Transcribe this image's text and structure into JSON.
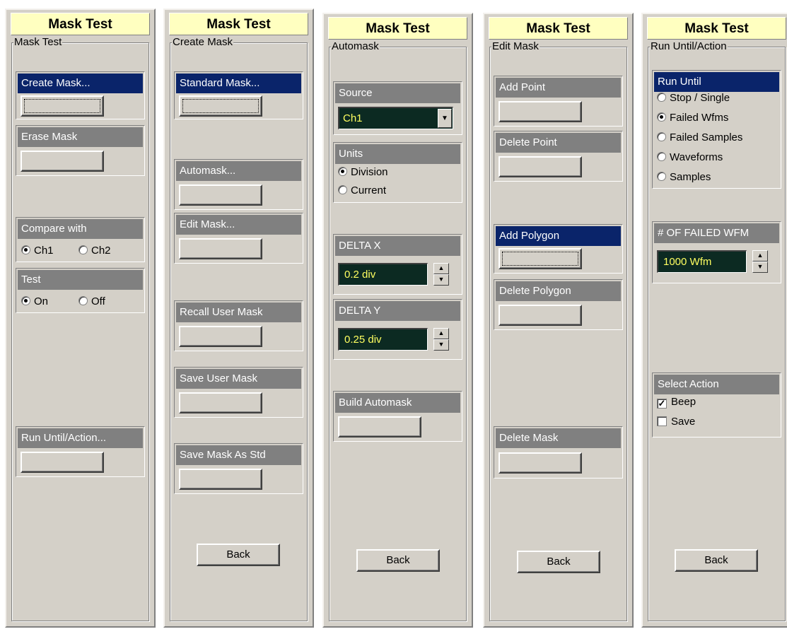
{
  "panels": [
    {
      "title": "Mask Test",
      "group_label": "Mask Test",
      "create_mask": "Create Mask...",
      "erase_mask": "Erase Mask",
      "compare_with": {
        "label": "Compare with",
        "options": [
          "Ch1",
          "Ch2"
        ],
        "selected": "Ch1"
      },
      "test": {
        "label": "Test",
        "options": [
          "On",
          "Off"
        ],
        "selected": "On"
      },
      "run_until_action": "Run Until/Action..."
    },
    {
      "title": "Mask Test",
      "group_label": "Create Mask",
      "standard_mask": "Standard Mask...",
      "automask": "Automask...",
      "edit_mask": "Edit Mask...",
      "recall_user_mask": "Recall User Mask",
      "save_user_mask": "Save User Mask",
      "save_mask_as_std": "Save Mask As Std",
      "back": "Back"
    },
    {
      "title": "Mask Test",
      "group_label": "Automask",
      "source": {
        "label": "Source",
        "value": "Ch1"
      },
      "units": {
        "label": "Units",
        "options": [
          "Division",
          "Current"
        ],
        "selected": "Division"
      },
      "delta_x": {
        "label": "DELTA X",
        "value": "0.2 div"
      },
      "delta_y": {
        "label": "DELTA Y",
        "value": "0.25 div"
      },
      "build_automask": "Build Automask",
      "back": "Back"
    },
    {
      "title": "Mask Test",
      "group_label": "Edit Mask",
      "add_point": "Add Point",
      "delete_point": "Delete Point",
      "add_polygon": "Add Polygon",
      "delete_polygon": "Delete Polygon",
      "delete_mask": "Delete Mask",
      "back": "Back"
    },
    {
      "title": "Mask Test",
      "group_label": "Run Until/Action",
      "run_until": {
        "label": "Run Until",
        "options": [
          "Stop / Single",
          "Failed Wfms",
          "Failed Samples",
          "Waveforms",
          "Samples"
        ],
        "selected": "Failed Wfms"
      },
      "failed_wfm": {
        "label": "# OF FAILED WFM",
        "value": "1000 Wfm"
      },
      "select_action": {
        "label": "Select Action",
        "beep": "Beep",
        "beep_checked": true,
        "save": "Save",
        "save_checked": false
      },
      "back": "Back"
    }
  ]
}
